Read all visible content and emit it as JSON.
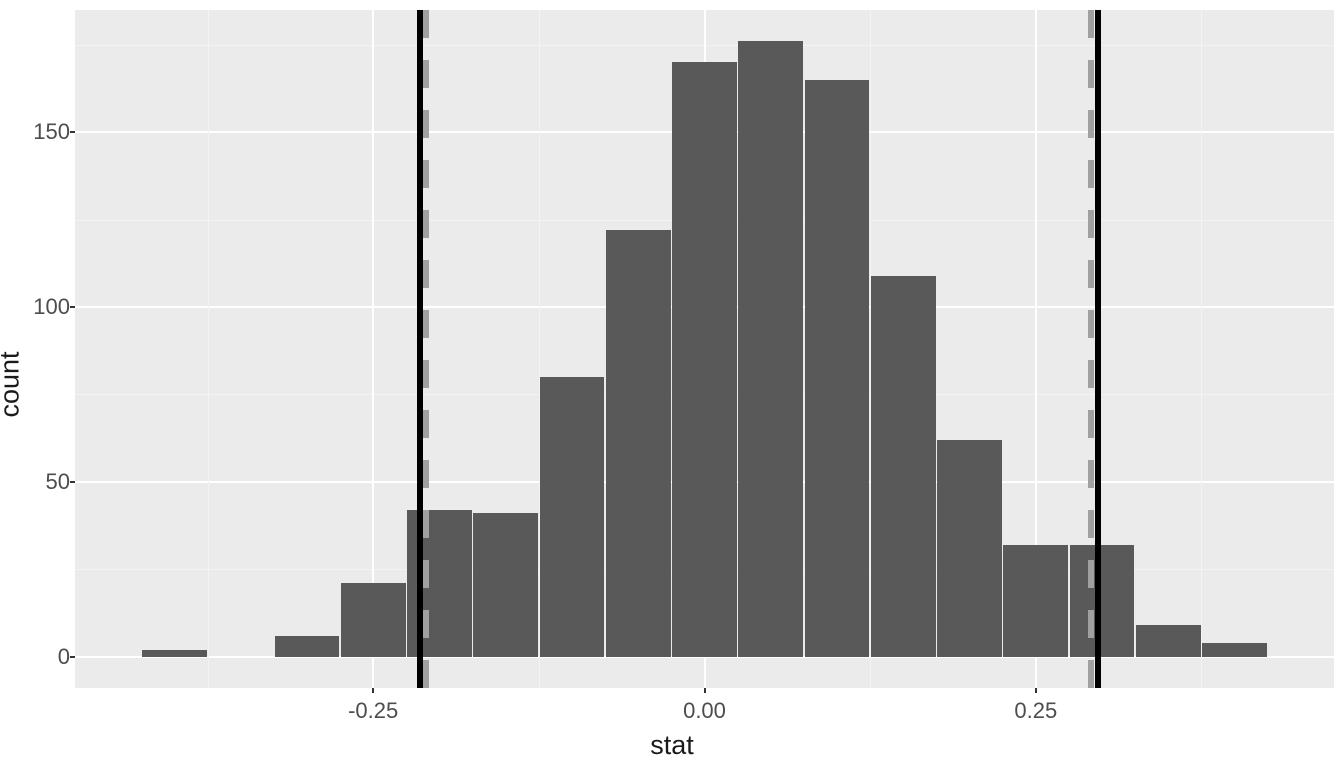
{
  "chart_data": {
    "type": "bar",
    "xlabel": "stat",
    "ylabel": "count",
    "x_ticks": [
      -0.25,
      0.0,
      0.25
    ],
    "x_tick_labels": [
      "-0.25",
      "0.00",
      "0.25"
    ],
    "y_ticks": [
      0,
      50,
      100,
      150
    ],
    "y_tick_labels": [
      "0",
      "50",
      "100",
      "150"
    ],
    "xlim": [
      -0.475,
      0.475
    ],
    "ylim": [
      -9,
      185
    ],
    "bin_width": 0.05,
    "bins": [
      {
        "center": -0.4,
        "count": 2
      },
      {
        "center": -0.35,
        "count": 0
      },
      {
        "center": -0.3,
        "count": 6
      },
      {
        "center": -0.25,
        "count": 21
      },
      {
        "center": -0.2,
        "count": 42
      },
      {
        "center": -0.15,
        "count": 41
      },
      {
        "center": -0.1,
        "count": 80
      },
      {
        "center": -0.05,
        "count": 122
      },
      {
        "center": 0.0,
        "count": 170
      },
      {
        "center": 0.05,
        "count": 176
      },
      {
        "center": 0.1,
        "count": 165
      },
      {
        "center": 0.15,
        "count": 109
      },
      {
        "center": 0.2,
        "count": 62
      },
      {
        "center": 0.25,
        "count": 32
      },
      {
        "center": 0.3,
        "count": 32
      },
      {
        "center": 0.35,
        "count": 9
      },
      {
        "center": 0.4,
        "count": 4
      }
    ],
    "vlines_solid": [
      -0.215,
      0.297
    ],
    "vlines_dashed": [
      -0.21,
      0.292
    ]
  }
}
